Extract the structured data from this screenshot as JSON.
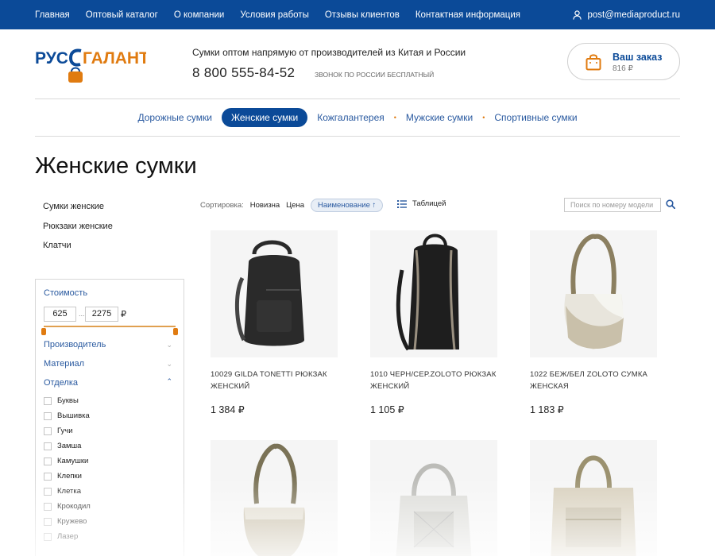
{
  "topnav": {
    "items": [
      "Главная",
      "Оптовый каталог",
      "О компании",
      "Условия работы",
      "Отзывы клиентов",
      "Контактная информация"
    ],
    "email": "post@mediaproduct.ru",
    "user_icon": "user-icon"
  },
  "header": {
    "logo_text": "РУСГАЛАНТ",
    "tagline": "Сумки оптом напрямую от производителей из Китая и России",
    "phone": "8 800 555-84-52",
    "phone_note": "Звонок по России бесплатный",
    "order_title": "Ваш заказ",
    "order_sum": "816 ₽"
  },
  "catnav": {
    "items": [
      "Дорожные сумки",
      "Женские сумки",
      "Кожгалантерея",
      "Мужские сумки",
      "Спортивные сумки"
    ],
    "active_index": 1
  },
  "page_title": "Женские сумки",
  "sidebar": {
    "links": [
      "Сумки женские",
      "Рюкзаки женские",
      "Клатчи"
    ],
    "price": {
      "label": "Стоимость",
      "min": "625",
      "max": "2275",
      "currency": "₽",
      "sep": "..."
    },
    "sections": [
      "Производитель",
      "Материал",
      "Отделка"
    ],
    "finish_options": [
      "Буквы",
      "Вышивка",
      "Гучи",
      "Замша",
      "Камушки",
      "Клепки",
      "Клетка",
      "Крокодил",
      "Кружево",
      "Лазер"
    ]
  },
  "toolbar": {
    "sort_label": "Сортировка:",
    "sort_options": [
      "Новизна",
      "Цена",
      "Наименование ↑"
    ],
    "sort_selected": 2,
    "view_label": "Таблицей",
    "search_placeholder": "Поиск по номеру модели"
  },
  "products": [
    {
      "name": "10029 GILDA TONETTI рюкзак женский",
      "price": "1 384 ₽",
      "bag": "backpack",
      "color": "#2a2a2a"
    },
    {
      "name": "1010 черн/сер.ZOLOTO рюкзак женский",
      "price": "1 105 ₽",
      "bag": "backpack2",
      "color": "#1e1e1e"
    },
    {
      "name": "1022 беж/бел ZOLOTO сумка женская",
      "price": "1 183 ₽",
      "bag": "hobo",
      "color": "#cfc7b2"
    },
    {
      "name": "",
      "price": "",
      "bag": "hobo",
      "color": "#b9ad95"
    },
    {
      "name": "",
      "price": "",
      "bag": "tote",
      "color": "#d9d9d6"
    },
    {
      "name": "",
      "price": "",
      "bag": "satchel",
      "color": "#cdc5b4"
    }
  ],
  "colors": {
    "brand_blue": "#0b4a98",
    "accent_orange": "#e07b10",
    "link_blue": "#2a5aa0"
  }
}
